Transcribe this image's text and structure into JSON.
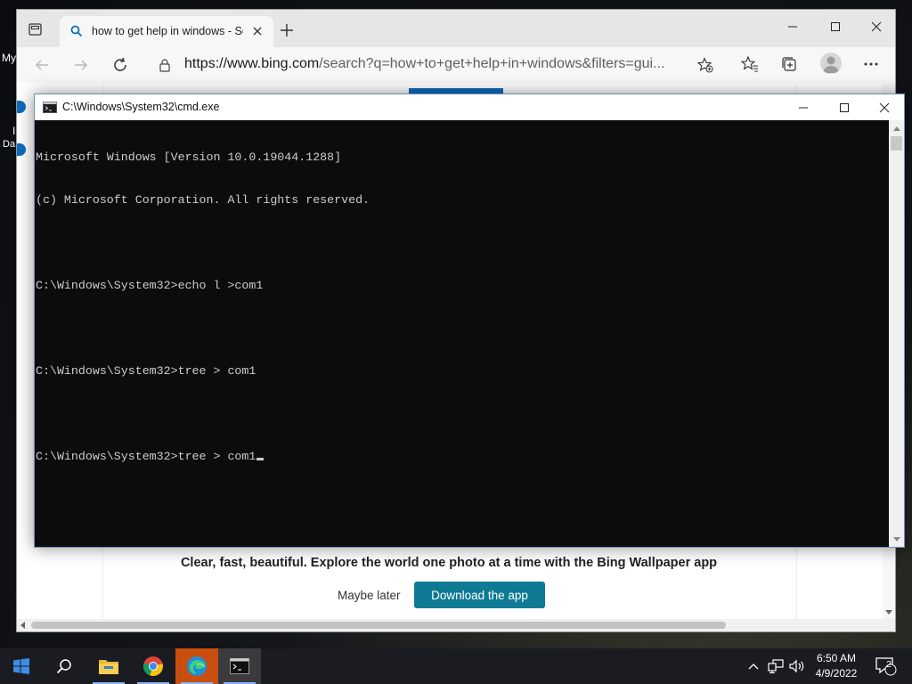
{
  "desktop": {
    "fragment_top": "My",
    "fragment_mid": "Da",
    "fragment_small": "I"
  },
  "browser": {
    "tab_title": "how to get help in windows - Se",
    "url_host": "https://www.bing.com",
    "url_path": "/search?q=how+to+get+help+in+windows&filters=gui...",
    "promo_text": "Clear, fast, beautiful. Explore the world one photo at a time with the Bing Wallpaper app",
    "maybe_later": "Maybe later",
    "download_label": "Download the app",
    "accent_color": "#0e7a93"
  },
  "cmd": {
    "title": "C:\\Windows\\System32\\cmd.exe",
    "lines": [
      "Microsoft Windows [Version 10.0.19044.1288]",
      "(c) Microsoft Corporation. All rights reserved.",
      "",
      "C:\\Windows\\System32>echo l >com1",
      "",
      "C:\\Windows\\System32>tree > com1",
      "",
      "C:\\Windows\\System32>tree > com1"
    ]
  },
  "taskbar": {
    "apps": [
      "start-icon",
      "search-icon",
      "file-explorer-icon",
      "chrome-icon",
      "edge-icon",
      "cmd-icon"
    ],
    "time": "6:50 AM",
    "date": "4/9/2022",
    "notification_count": "2"
  }
}
